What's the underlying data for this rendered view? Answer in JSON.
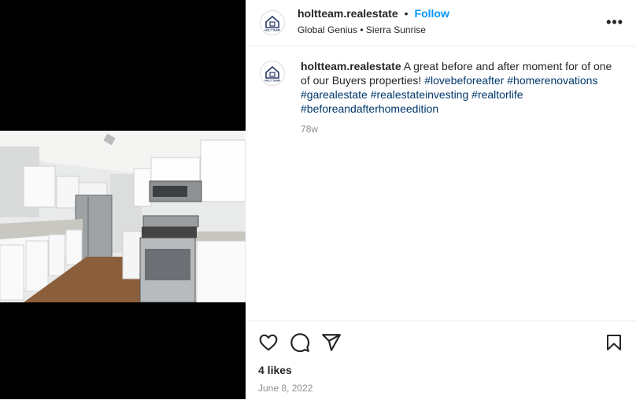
{
  "post": {
    "username": "holtteam.realestate",
    "dot": "•",
    "follow": "Follow",
    "subline": "Global Genius • Sierra Sunrise",
    "more": "•••",
    "caption_text": " A great before and after moment for of one of our Buyers properties! ",
    "hashtags": [
      "#lovebeforeafter",
      "#homerenovations",
      "#garealestate",
      "#realestateinvesting",
      "#realtorlife",
      "#beforeandafterhomeedition"
    ],
    "age": "78w",
    "likes": "4 likes",
    "date": "June 8, 2022"
  },
  "logo_text": "HOLT TEAM",
  "icons": [
    "heart-icon",
    "comment-icon",
    "share-icon",
    "bookmark-icon",
    "more-icon"
  ],
  "colors": {
    "link": "#0095f6",
    "hashtag": "#00376b",
    "muted": "#8e8e8e"
  }
}
